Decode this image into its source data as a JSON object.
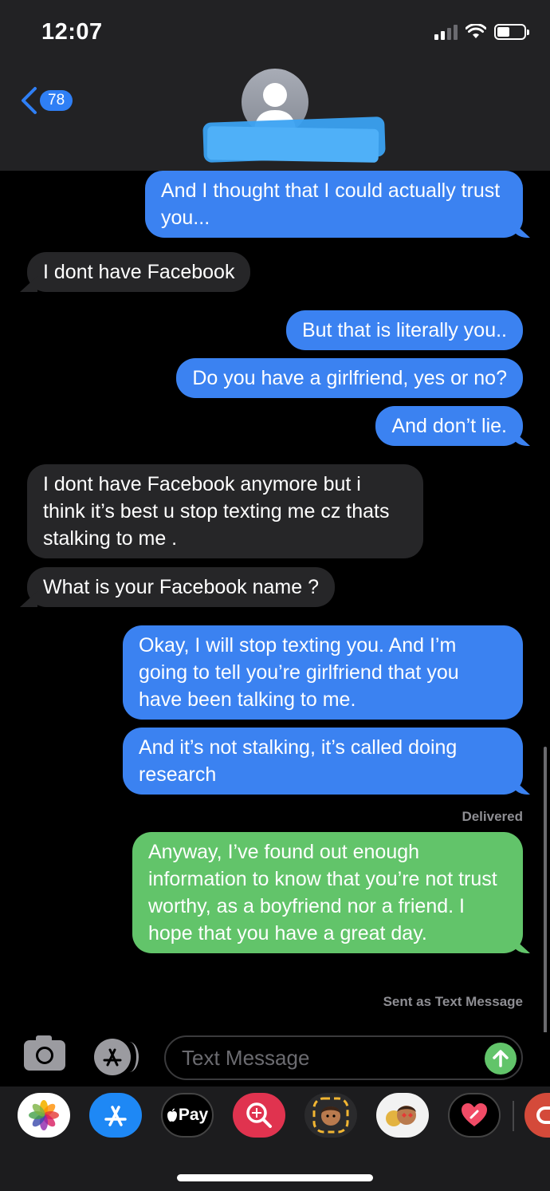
{
  "status_bar": {
    "time": "12:07"
  },
  "nav": {
    "back_count": "78"
  },
  "messages": [
    {
      "text": "And I thought that I could actually trust you..."
    },
    {
      "text": "I dont have Facebook"
    },
    {
      "text": "But that is literally you.."
    },
    {
      "text": "Do you have a girlfriend, yes or no?"
    },
    {
      "text": "And don’t lie."
    },
    {
      "text": "I dont have Facebook anymore but i think it’s best u stop texting me cz thats stalking to me ."
    },
    {
      "text": "What is your Facebook name ?"
    },
    {
      "text": "Okay, I will stop texting you. And I’m going to tell you’re girlfriend that you have been talking to me."
    },
    {
      "text": "And it’s not stalking, it’s called doing research"
    },
    {
      "text": "Anyway, I’ve found out enough information to know that you’re not trust worthy, as a boyfriend nor a friend. I hope that you have a great day."
    }
  ],
  "receipts": {
    "delivered": "Delivered",
    "sent_as_text": "Sent as Text Message"
  },
  "composer": {
    "placeholder": "Text Message"
  },
  "app_drawer": {
    "apple_pay_label": "Pay",
    "icons": [
      "photos-icon",
      "app-store-icon",
      "apple-pay-icon",
      "search-images-icon",
      "memoji-icon",
      "memoji-stickers-icon",
      "digital-touch-icon",
      "partial-app-icon"
    ]
  },
  "colors": {
    "imessage_blue": "#3b82f1",
    "sms_green": "#62c46a",
    "incoming_gray": "#262628",
    "header_bg": "#222224"
  }
}
